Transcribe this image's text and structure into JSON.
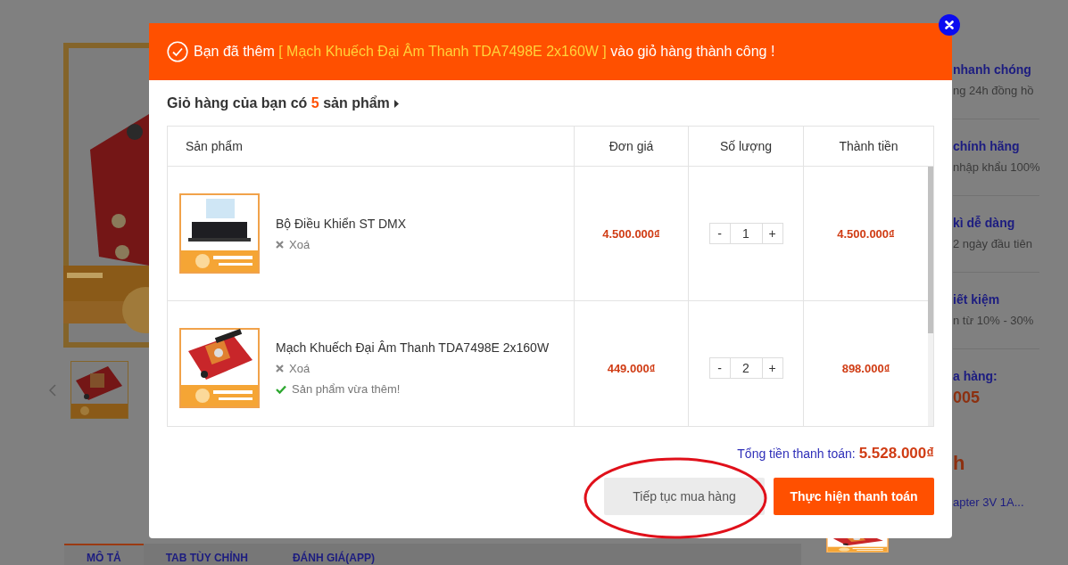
{
  "background_page": {
    "features": [
      {
        "title": "nhanh chóng",
        "subtitle": "ng 24h đồng hồ"
      },
      {
        "title": "chính hãng",
        "subtitle": "nhập khẩu 100%"
      },
      {
        "title": "kì dễ dàng",
        "subtitle": "2 ngày đầu tiên"
      },
      {
        "title": "iết kiệm",
        "subtitle": "n từ 10% - 30%"
      }
    ],
    "hotline": {
      "label": "a hàng:",
      "number": "005"
    },
    "related": {
      "heading": "h",
      "product": "apter 3V 1A..."
    },
    "tabs": [
      {
        "label": "MÔ TẢ",
        "selected": true
      },
      {
        "label": "TAB TÙY CHỈNH",
        "selected": false
      },
      {
        "label": "ĐÁNH GIÁ(APP)",
        "selected": false
      }
    ]
  },
  "dialog": {
    "notice": {
      "prefix": "Bạn đã thêm",
      "product": "[ Mạch Khuếch Đại Âm Thanh TDA7498E 2x160W ]",
      "suffix": "vào giỏ hàng thành công !"
    },
    "summary": {
      "before": "Giỏ hàng của bạn có",
      "count": "5",
      "after": "sản phẩm"
    },
    "table": {
      "columns": [
        "Sản phẩm",
        "Đơn giá",
        "Số lượng",
        "Thành tiền"
      ],
      "rows": [
        {
          "name": "Bộ Điều Khiển ST DMX",
          "remove": "Xoá",
          "price": "4.500.000₫",
          "decrement": "-",
          "quantity": "1",
          "increment": "+",
          "total": "4.500.000₫"
        },
        {
          "name": "Mạch Khuếch Đại Âm Thanh TDA7498E 2x160W",
          "remove": "Xoá",
          "note": "Sản phẩm vừa thêm!",
          "price": "449.000₫",
          "decrement": "-",
          "quantity": "2",
          "increment": "+",
          "total": "898.000₫"
        }
      ]
    },
    "total": {
      "label": "Tổng tiền thanh toán:",
      "value": "5.528.000₫"
    },
    "buttons": [
      {
        "label": "Tiếp tục mua hàng",
        "kind": "secondary"
      },
      {
        "label": "Thực hiện thanh toán",
        "kind": "primary"
      }
    ],
    "highlight_ellipse": true
  }
}
